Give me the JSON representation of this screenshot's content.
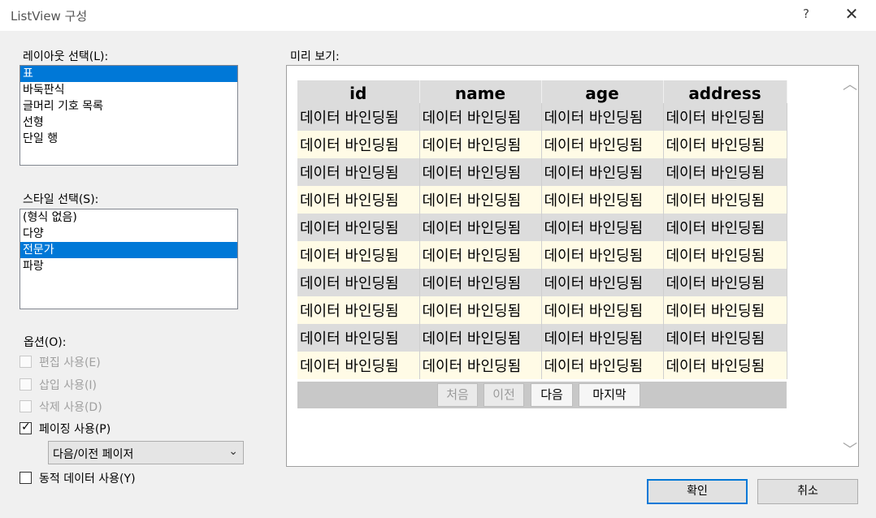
{
  "window": {
    "title": "ListView 구성",
    "help_label": "?",
    "close_label": "✕"
  },
  "layout_section": {
    "label": "레이아웃 선택(L):",
    "items": [
      "표",
      "바둑판식",
      "글머리 기호 목록",
      "선형",
      "단일 행"
    ],
    "selected": "표"
  },
  "style_section": {
    "label": "스타일 선택(S):",
    "items": [
      "(형식 없음)",
      "다양",
      "전문가",
      "파랑"
    ],
    "selected": "전문가"
  },
  "options": {
    "label": "옵션(O):",
    "edit": {
      "label": "편집 사용(E)",
      "checked": false,
      "enabled": false
    },
    "insert": {
      "label": "삽입 사용(I)",
      "checked": false,
      "enabled": false
    },
    "delete": {
      "label": "삭제 사용(D)",
      "checked": false,
      "enabled": false
    },
    "paging": {
      "label": "페이징 사용(P)",
      "checked": true,
      "enabled": true
    },
    "pager_mode": "다음/이전 페이저",
    "dynamic": {
      "label": "동적 데이터 사용(Y)",
      "checked": false,
      "enabled": true
    }
  },
  "preview": {
    "label": "미리 보기:",
    "columns": [
      "id",
      "name",
      "age",
      "address"
    ],
    "rows": [
      [
        "데이터 바인딩됨",
        "데이터 바인딩됨",
        "데이터 바인딩됨",
        "데이터 바인딩됨"
      ],
      [
        "데이터 바인딩됨",
        "데이터 바인딩됨",
        "데이터 바인딩됨",
        "데이터 바인딩됨"
      ],
      [
        "데이터 바인딩됨",
        "데이터 바인딩됨",
        "데이터 바인딩됨",
        "데이터 바인딩됨"
      ],
      [
        "데이터 바인딩됨",
        "데이터 바인딩됨",
        "데이터 바인딩됨",
        "데이터 바인딩됨"
      ],
      [
        "데이터 바인딩됨",
        "데이터 바인딩됨",
        "데이터 바인딩됨",
        "데이터 바인딩됨"
      ],
      [
        "데이터 바인딩됨",
        "데이터 바인딩됨",
        "데이터 바인딩됨",
        "데이터 바인딩됨"
      ],
      [
        "데이터 바인딩됨",
        "데이터 바인딩됨",
        "데이터 바인딩됨",
        "데이터 바인딩됨"
      ],
      [
        "데이터 바인딩됨",
        "데이터 바인딩됨",
        "데이터 바인딩됨",
        "데이터 바인딩됨"
      ],
      [
        "데이터 바인딩됨",
        "데이터 바인딩됨",
        "데이터 바인딩됨",
        "데이터 바인딩됨"
      ],
      [
        "데이터 바인딩됨",
        "데이터 바인딩됨",
        "데이터 바인딩됨",
        "데이터 바인딩됨"
      ]
    ],
    "pager": {
      "first": "처음",
      "prev": "이전",
      "next": "다음",
      "last": "마지막"
    }
  },
  "footer": {
    "ok": "확인",
    "cancel": "취소"
  },
  "colors": {
    "selection": "#0078d7",
    "header_bg": "#dcdcdc",
    "row_alt_bg": "#fffbe6"
  }
}
